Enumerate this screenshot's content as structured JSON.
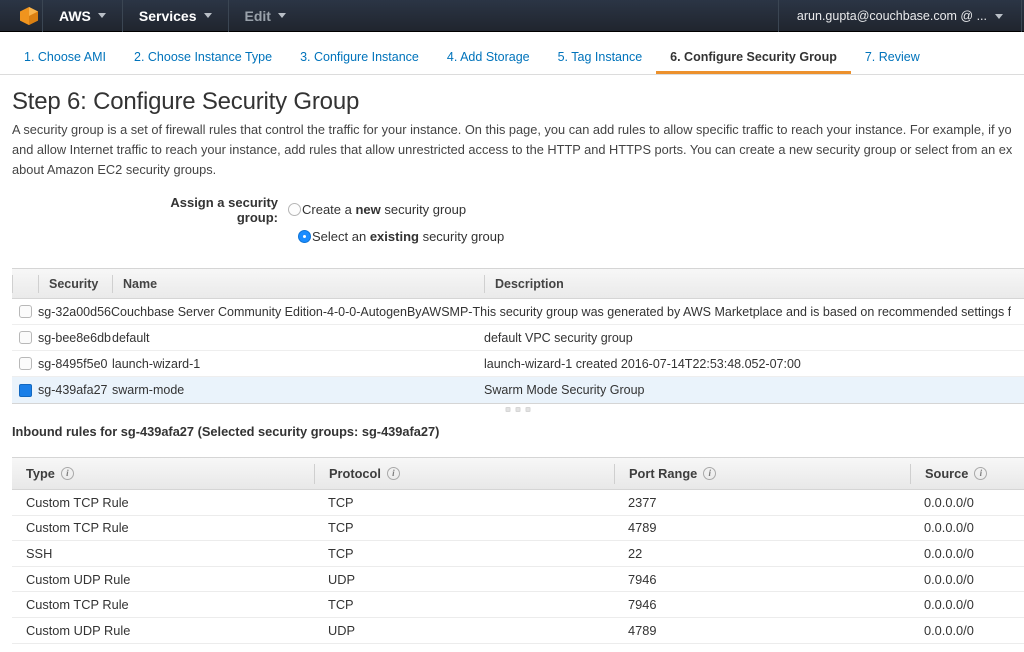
{
  "topnav": {
    "logo_icon": "aws-cube-icon",
    "aws_label": "AWS",
    "services_label": "Services",
    "edit_label": "Edit",
    "account_label": "arun.gupta@couchbase.com @ ...",
    "caret_icon": "chevron-down-icon"
  },
  "wizard": {
    "steps": [
      {
        "label": "1. Choose AMI",
        "active": false
      },
      {
        "label": "2. Choose Instance Type",
        "active": false
      },
      {
        "label": "3. Configure Instance",
        "active": false
      },
      {
        "label": "4. Add Storage",
        "active": false
      },
      {
        "label": "5. Tag Instance",
        "active": false
      },
      {
        "label": "6. Configure Security Group",
        "active": true
      },
      {
        "label": "7. Review",
        "active": false
      }
    ],
    "accent_color": "#ec912d",
    "link_color": "#0073bb"
  },
  "page": {
    "title": "Step 6: Configure Security Group",
    "description_line_1": "A security group is a set of firewall rules that control the traffic for your instance. On this page, you can add rules to allow specific traffic to reach your instance. For example, if you",
    "description_line_2": "and allow Internet traffic to reach your instance, add rules that allow unrestricted access to the HTTP and HTTPS ports. You can create a new security group or select from an exis",
    "description_line_3": "about Amazon EC2 security groups."
  },
  "assign": {
    "label": "Assign a security group:",
    "option_new_pre": "Create a ",
    "option_new_bold": "new",
    "option_new_post": " security group",
    "option_new_selected": false,
    "option_existing_pre": "Select an ",
    "option_existing_bold": "existing",
    "option_existing_post": " security group",
    "option_existing_selected": true
  },
  "sg_table": {
    "headers": {
      "checkbox": "",
      "security_group_id": "Security",
      "name": "Name",
      "description": "Description"
    },
    "rows": [
      {
        "checked": false,
        "sgid": "sg-32a00d56",
        "name": "Couchbase Server Community Edition-4-0-0-AutogenByAWSMP-",
        "description": "This security group was generated by AWS Marketplace and is based on recommended settings f",
        "selected": false,
        "overflow": true
      },
      {
        "checked": false,
        "sgid": "sg-bee8e6db",
        "name": "default",
        "description": "default VPC security group",
        "selected": false,
        "overflow": false
      },
      {
        "checked": false,
        "sgid": "sg-8495f5e0",
        "name": "launch-wizard-1",
        "description": "launch-wizard-1 created 2016-07-14T22:53:48.052-07:00",
        "selected": false,
        "overflow": false
      },
      {
        "checked": true,
        "sgid": "sg-439afa27",
        "name": "swarm-mode",
        "description": "Swarm Mode Security Group",
        "selected": true,
        "overflow": false
      }
    ]
  },
  "inbound": {
    "title": "Inbound rules for sg-439afa27 (Selected security groups: sg-439afa27)",
    "splitter_icon": "drag-handle-dots-icon",
    "headers": {
      "type": "Type",
      "protocol": "Protocol",
      "port_range": "Port Range",
      "source": "Source",
      "info_icon": "info-icon",
      "info_glyph": "i"
    },
    "rows": [
      {
        "type": "Custom TCP Rule",
        "protocol": "TCP",
        "port": "2377",
        "source": "0.0.0.0/0"
      },
      {
        "type": "Custom TCP Rule",
        "protocol": "TCP",
        "port": "4789",
        "source": "0.0.0.0/0"
      },
      {
        "type": "SSH",
        "protocol": "TCP",
        "port": "22",
        "source": "0.0.0.0/0"
      },
      {
        "type": "Custom UDP Rule",
        "protocol": "UDP",
        "port": "7946",
        "source": "0.0.0.0/0"
      },
      {
        "type": "Custom TCP Rule",
        "protocol": "TCP",
        "port": "7946",
        "source": "0.0.0.0/0"
      },
      {
        "type": "Custom UDP Rule",
        "protocol": "UDP",
        "port": "4789",
        "source": "0.0.0.0/0"
      }
    ]
  }
}
